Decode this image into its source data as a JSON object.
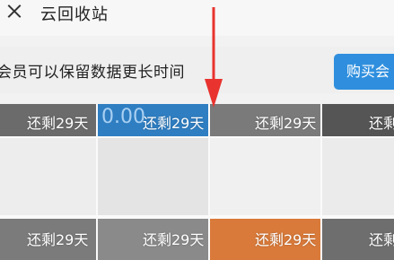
{
  "header": {
    "close_icon": "close-icon",
    "title": "云回收站"
  },
  "banner": {
    "text": "会员可以保留数据更长时间",
    "buy_label": "购买会"
  },
  "grid": {
    "remain_label": "还剩29天",
    "tiles_row1": [
      {
        "overlay_text": "还剩29天",
        "color": "#6b6b6b"
      },
      {
        "overlay_text": "还剩29天",
        "preview": "0.00",
        "color": "#2f7ec2"
      },
      {
        "overlay_text": "还剩29天",
        "color": "#7a7a7a"
      },
      {
        "overlay_text": "还剩",
        "color": "#555555"
      }
    ],
    "tiles_row2": [
      {
        "overlay_text": "还剩29天",
        "color": "#7b7b7b"
      },
      {
        "overlay_text": "还剩29天",
        "color": "#8a8a8a"
      },
      {
        "overlay_text": "还剩29天",
        "color": "#d97a3a"
      },
      {
        "overlay_text": "还剩",
        "color": "#6e6e6e"
      }
    ]
  },
  "annotation": {
    "arrow_color": "#e8332f"
  }
}
